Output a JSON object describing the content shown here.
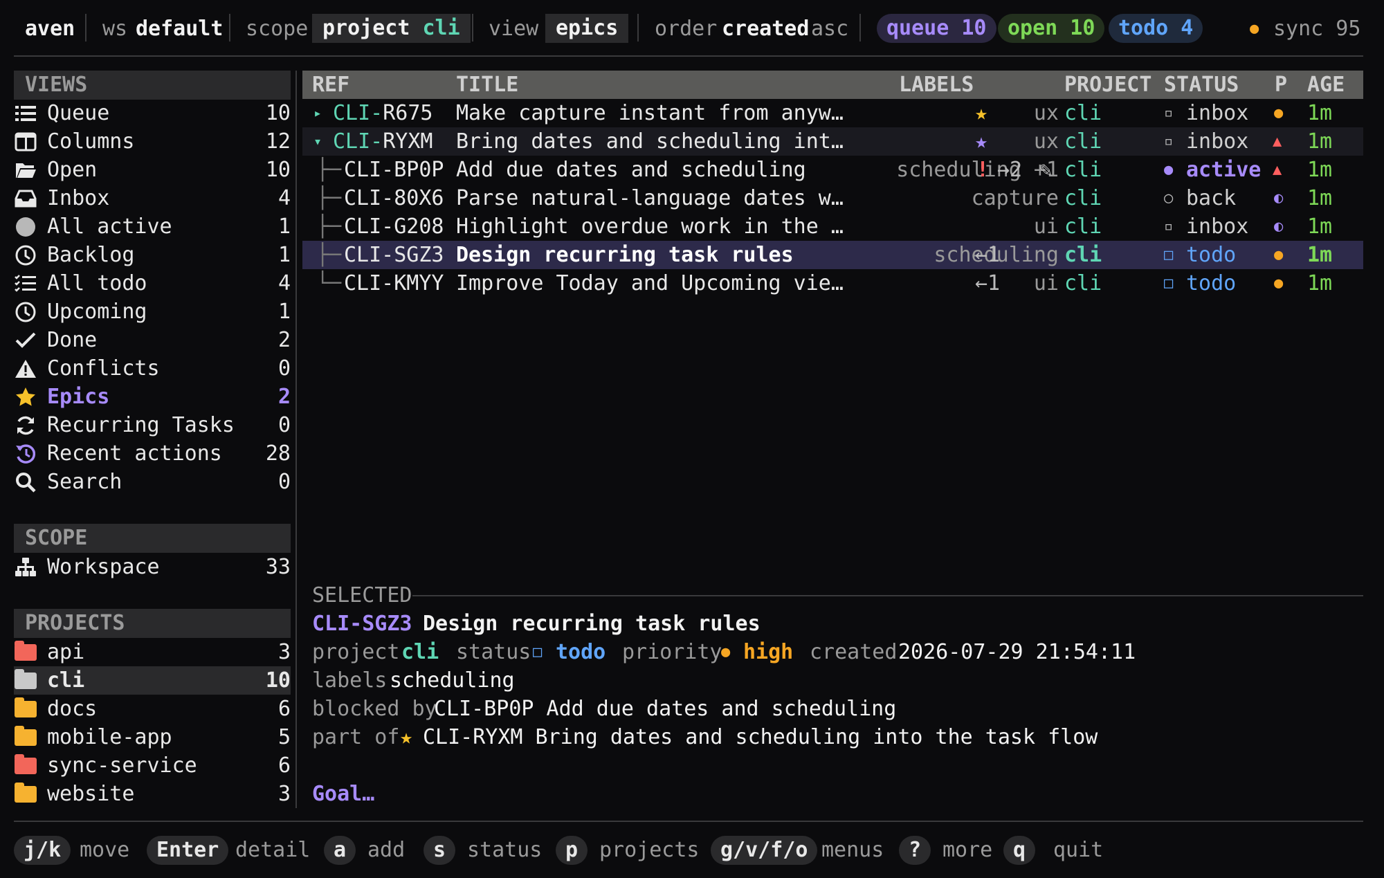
{
  "header": {
    "user": "aven",
    "ws_label": "ws",
    "ws_value": "default",
    "scope_label": "scope",
    "scope_project_label": "project",
    "scope_project_value": "cli",
    "view_label": "view",
    "view_value": "epics",
    "order_label": "order",
    "order_field": "created",
    "order_dir": "asc",
    "pills": [
      {
        "text": "queue 10",
        "color": "#a78bfa"
      },
      {
        "text": "open 10",
        "color": "#7ed957"
      },
      {
        "text": "todo 4",
        "color": "#60a5fa"
      }
    ],
    "sync_dot": "●",
    "sync_text": "sync 95"
  },
  "sidebar": {
    "views_title": "VIEWS",
    "views": [
      {
        "label": "Queue",
        "count": "10",
        "icon": "list-icon"
      },
      {
        "label": "Columns",
        "count": "12",
        "icon": "columns-icon"
      },
      {
        "label": "Open",
        "count": "10",
        "icon": "folder-open-icon"
      },
      {
        "label": "Inbox",
        "count": "4",
        "icon": "inbox-icon"
      },
      {
        "label": "All active",
        "count": "1",
        "icon": "circle-icon"
      },
      {
        "label": "Backlog",
        "count": "1",
        "icon": "clock-icon"
      },
      {
        "label": "All todo",
        "count": "4",
        "icon": "checklist-icon"
      },
      {
        "label": "Upcoming",
        "count": "1",
        "icon": "clock-icon"
      },
      {
        "label": "Done",
        "count": "2",
        "icon": "check-icon"
      },
      {
        "label": "Conflicts",
        "count": "0",
        "icon": "warning-icon"
      },
      {
        "label": "Epics",
        "count": "2",
        "icon": "star-icon"
      },
      {
        "label": "Recurring Tasks",
        "count": "0",
        "icon": "refresh-icon"
      },
      {
        "label": "Recent actions",
        "count": "28",
        "icon": "history-icon"
      },
      {
        "label": "Search",
        "count": "0",
        "icon": "search-icon"
      }
    ],
    "scope_title": "SCOPE",
    "scope_items": [
      {
        "label": "Workspace",
        "count": "33",
        "icon": "sitemap-icon"
      }
    ],
    "projects_title": "PROJECTS",
    "projects": [
      {
        "label": "api",
        "count": "3",
        "color": "#f2665a"
      },
      {
        "label": "cli",
        "count": "10",
        "color": "#c9c9c9"
      },
      {
        "label": "docs",
        "count": "6",
        "color": "#f6b230"
      },
      {
        "label": "mobile-app",
        "count": "5",
        "color": "#f6b230"
      },
      {
        "label": "sync-service",
        "count": "6",
        "color": "#f2665a"
      },
      {
        "label": "website",
        "count": "3",
        "color": "#f6b230"
      }
    ]
  },
  "table": {
    "columns": {
      "ref": "REF",
      "title": "TITLE",
      "labels": "LABELS",
      "project": "PROJECT",
      "status": "STATUS",
      "p": "P",
      "age": "AGE"
    },
    "rows": [
      {
        "tree": "▸",
        "ref": "CLI-R675",
        "title": "Make capture instant from anyw…",
        "labels": "ux",
        "mark": "★",
        "mark_color": "#f6c12a",
        "project": "cli",
        "status_icon": "▫",
        "status": "inbox",
        "status_color": "#d0d0d0",
        "pri": "●",
        "pri_color": "#f6a623",
        "age": "1m"
      },
      {
        "tree": "▾",
        "ref": "CLI-RYXM",
        "title": "Bring dates and scheduling int…",
        "labels": "ux",
        "mark": "★",
        "mark_color": "#a78bfa",
        "project": "cli",
        "status_icon": "▫",
        "status": "inbox",
        "status_color": "#d0d0d0",
        "pri": "▲",
        "pri_color": "#ff5f5f",
        "age": "1m"
      },
      {
        "tree": "├─",
        "ref": "CLI-BP0P",
        "title": "Add due dates and scheduling",
        "labels": "scheduling +1",
        "flag": "!",
        "links": "→2",
        "edit": "✎",
        "project": "cli",
        "status_icon": "●",
        "status": "active",
        "status_color": "#a78bfa",
        "pri": "▲",
        "pri_color": "#ff5f5f",
        "age": "1m"
      },
      {
        "tree": "├─",
        "ref": "CLI-80X6",
        "title": "Parse natural-language dates w…",
        "labels": "capture",
        "project": "cli",
        "status_icon": "○",
        "status": "back",
        "status_color": "#d0d0d0",
        "pri": "◐",
        "pri_color": "#a78bfa",
        "age": "1m"
      },
      {
        "tree": "├─",
        "ref": "CLI-G208",
        "title": "Highlight overdue work in the …",
        "labels": "ui",
        "project": "cli",
        "status_icon": "▫",
        "status": "inbox",
        "status_color": "#d0d0d0",
        "pri": "◐",
        "pri_color": "#a78bfa",
        "age": "1m"
      },
      {
        "tree": "├─",
        "ref": "CLI-SGZ3",
        "title": "Design recurring task rules",
        "labels": "scheduling",
        "links": "←1",
        "project": "cli",
        "status_icon": "□",
        "status": "todo",
        "status_color": "#60a5fa",
        "pri": "●",
        "pri_color": "#f6a623",
        "age": "1m"
      },
      {
        "tree": "└─",
        "ref": "CLI-KMYY",
        "title": "Improve Today and Upcoming vie…",
        "labels": "ui",
        "links": "←1",
        "project": "cli",
        "status_icon": "□",
        "status": "todo",
        "status_color": "#60a5fa",
        "pri": "●",
        "pri_color": "#f6a623",
        "age": "1m"
      }
    ]
  },
  "selected": {
    "section_title": "SELECTED",
    "ref": "CLI-SGZ3",
    "title": "Design recurring task rules",
    "project_label": "project",
    "project": "cli",
    "status_label": "status",
    "status_icon": "□",
    "status": "todo",
    "priority_label": "priority",
    "priority_icon": "●",
    "priority": "high",
    "created_label": "created",
    "created": "2026-07-29 21:54:11",
    "labels_label": "labels",
    "labels": "scheduling",
    "blocked_label": "blocked by",
    "blocked": "CLI-BP0P Add due dates and scheduling",
    "partof_label": "part of",
    "partof_icon": "★",
    "partof": "CLI-RYXM Bring dates and scheduling into the task flow",
    "goal": "Goal…"
  },
  "footer": {
    "keys": [
      {
        "key": "j/k",
        "label": "move"
      },
      {
        "key": "Enter",
        "label": "detail"
      },
      {
        "key": "a",
        "label": "add"
      },
      {
        "key": "s",
        "label": "status"
      },
      {
        "key": "p",
        "label": "projects"
      },
      {
        "key": "g/v/f/o",
        "label": "menus"
      },
      {
        "key": "?",
        "label": "more"
      },
      {
        "key": "q",
        "label": "quit"
      }
    ]
  }
}
